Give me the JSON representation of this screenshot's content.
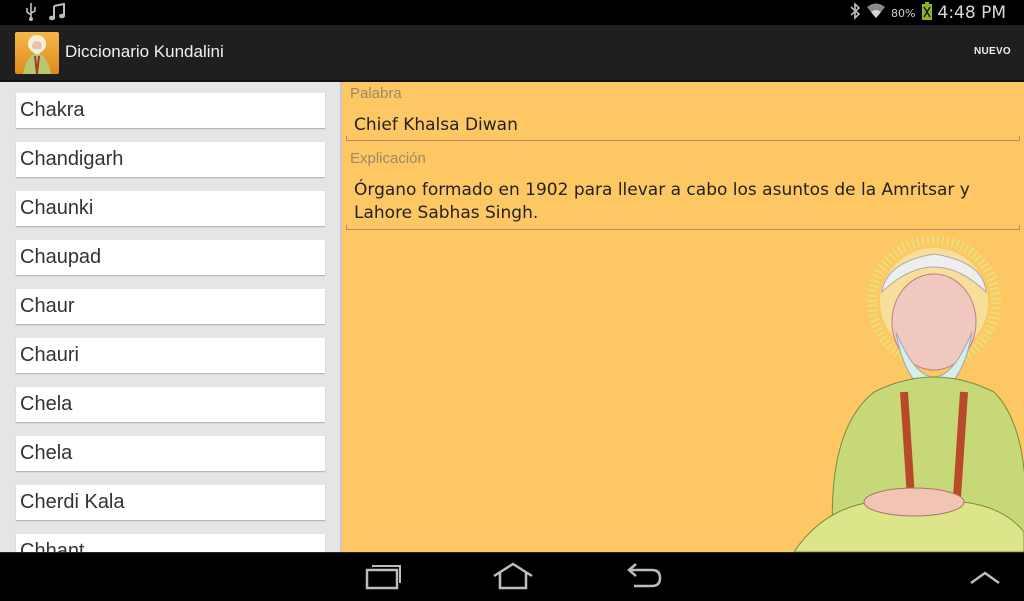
{
  "status": {
    "battery": "80%",
    "time": "4:48 PM"
  },
  "header": {
    "title": "Diccionario Kundalini",
    "action": "NUEVO"
  },
  "list": [
    "Chakra",
    "Chandigarh",
    "Chaunki",
    "Chaupad",
    "Chaur",
    "Chauri",
    "Chela",
    "Chela",
    "Cherdi Kala",
    "Chhant"
  ],
  "detail": {
    "word_label": "Palabra",
    "word_value": "Chief Khalsa Diwan",
    "explain_label": "Explicación",
    "explain_line1": "Órgano formado en 1902 para llevar a cabo los asuntos de la Amritsar y",
    "explain_line2": "Lahore Sabhas Singh."
  },
  "colors": {
    "detail_bg": "#fdc763",
    "list_bg": "#e5e5e5",
    "actionbar": "#1f1f1f"
  }
}
